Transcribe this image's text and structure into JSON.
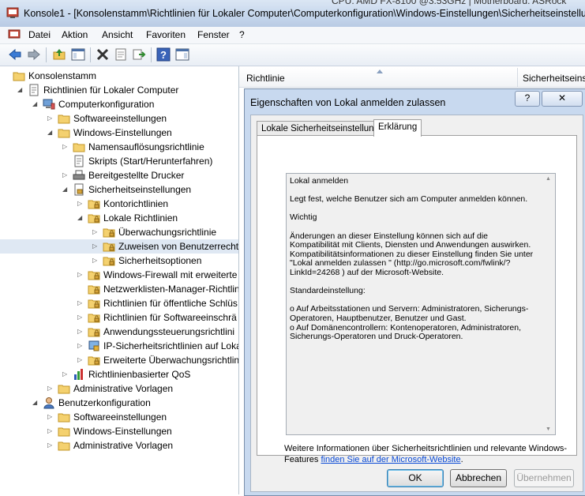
{
  "window": {
    "title": "Konsole1 - [Konsolenstamm\\Richtlinien für Lokaler Computer\\Computerkonfiguration\\Windows-Einstellungen\\Sicherheitseinstellunge",
    "topcut": "CPU: AMD FX-8100 @3.53GHz | Motherboard: ASRock"
  },
  "menu": [
    "Datei",
    "Aktion",
    "Ansicht",
    "Favoriten",
    "Fenster",
    "?"
  ],
  "tree": [
    {
      "label": "Konsolenstamm",
      "indent": 0,
      "icon": "console-root-icon",
      "exp": ""
    },
    {
      "label": "Richtlinien für Lokaler Computer",
      "indent": 1,
      "icon": "policy-doc-icon",
      "exp": "open"
    },
    {
      "label": "Computerkonfiguration",
      "indent": 2,
      "icon": "computer-icon",
      "exp": "open"
    },
    {
      "label": "Softwareeinstellungen",
      "indent": 3,
      "icon": "folder-icon",
      "exp": "closed"
    },
    {
      "label": "Windows-Einstellungen",
      "indent": 3,
      "icon": "folder-icon",
      "exp": "open"
    },
    {
      "label": "Namensauflösungsrichtlinie",
      "indent": 4,
      "icon": "folder-icon",
      "exp": "closed"
    },
    {
      "label": "Skripts (Start/Herunterfahren)",
      "indent": 4,
      "icon": "script-icon",
      "exp": ""
    },
    {
      "label": "Bereitgestellte Drucker",
      "indent": 4,
      "icon": "printer-icon",
      "exp": "closed"
    },
    {
      "label": "Sicherheitseinstellungen",
      "indent": 4,
      "icon": "security-icon",
      "exp": "open"
    },
    {
      "label": "Kontorichtlinien",
      "indent": 5,
      "icon": "folder-lock-icon",
      "exp": "closed"
    },
    {
      "label": "Lokale Richtlinien",
      "indent": 5,
      "icon": "folder-lock-icon",
      "exp": "open"
    },
    {
      "label": "Überwachungsrichtlinie",
      "indent": 6,
      "icon": "folder-lock-icon",
      "exp": "closed"
    },
    {
      "label": "Zuweisen von Benutzerrecht",
      "indent": 6,
      "icon": "folder-lock-icon",
      "exp": "closed",
      "selected": true
    },
    {
      "label": "Sicherheitsoptionen",
      "indent": 6,
      "icon": "folder-lock-icon",
      "exp": "closed"
    },
    {
      "label": "Windows-Firewall mit erweiterte",
      "indent": 5,
      "icon": "folder-lock-icon",
      "exp": "closed"
    },
    {
      "label": "Netzwerklisten-Manager-Richtlin",
      "indent": 5,
      "icon": "folder-lock-icon",
      "exp": ""
    },
    {
      "label": "Richtlinien für öffentliche Schlüs",
      "indent": 5,
      "icon": "folder-lock-icon",
      "exp": "closed"
    },
    {
      "label": "Richtlinien für Softwareeinschrä",
      "indent": 5,
      "icon": "folder-lock-icon",
      "exp": "closed"
    },
    {
      "label": "Anwendungssteuerungsrichtlini",
      "indent": 5,
      "icon": "folder-lock-icon",
      "exp": "closed"
    },
    {
      "label": "IP-Sicherheitsrichtlinien auf Loka",
      "indent": 5,
      "icon": "ipsec-icon",
      "exp": "closed"
    },
    {
      "label": "Erweiterte Überwachungsrichtlin",
      "indent": 5,
      "icon": "folder-lock-icon",
      "exp": "closed"
    },
    {
      "label": "Richtlinienbasierter QoS",
      "indent": 4,
      "icon": "qos-chart-icon",
      "exp": "closed"
    },
    {
      "label": "Administrative Vorlagen",
      "indent": 3,
      "icon": "folder-icon",
      "exp": "closed"
    },
    {
      "label": "Benutzerkonfiguration",
      "indent": 2,
      "icon": "user-icon",
      "exp": "open"
    },
    {
      "label": "Softwareeinstellungen",
      "indent": 3,
      "icon": "folder-icon",
      "exp": "closed"
    },
    {
      "label": "Windows-Einstellungen",
      "indent": 3,
      "icon": "folder-icon",
      "exp": "closed"
    },
    {
      "label": "Administrative Vorlagen",
      "indent": 3,
      "icon": "folder-icon",
      "exp": "closed"
    }
  ],
  "list": {
    "col1": "Richtlinie",
    "col2": "Sicherheitseinst"
  },
  "dialog": {
    "title": "Eigenschaften von Lokal anmelden zulassen",
    "help": "?",
    "close": "✕",
    "tabs": [
      "Lokale Sicherheitseinstellung",
      "Erklärung"
    ],
    "text": [
      "Lokal anmelden",
      "Legt fest, welche Benutzer sich am Computer anmelden können.",
      "Wichtig",
      "Änderungen an dieser Einstellung können sich auf die Kompatibilität mit Clients, Diensten und Anwendungen auswirken. Kompatibilitätsinformationen zu dieser Einstellung finden Sie unter \"Lokal anmelden zulassen \" (http://go.microsoft.com/fwlink/?LinkId=24268 ) auf der Microsoft-Website.",
      "Standardeinstellung:",
      "o Auf Arbeitsstationen und Servern: Administratoren, Sicherungs-Operatoren, Hauptbenutzer, Benutzer und Gast.\no Auf Domänencontrollern: Kontenoperatoren, Administratoren, Sicherungs-Operatoren und Druck-Operatoren."
    ],
    "moreinfo": "Weitere Informationen über Sicherheitsrichtlinien und relevante Windows-Features ",
    "moreinfo_link": "finden Sie auf der Microsoft-Website",
    "moreinfo_end": ".",
    "ok": "OK",
    "cancel": "Abbrechen",
    "apply": "Übernehmen"
  }
}
